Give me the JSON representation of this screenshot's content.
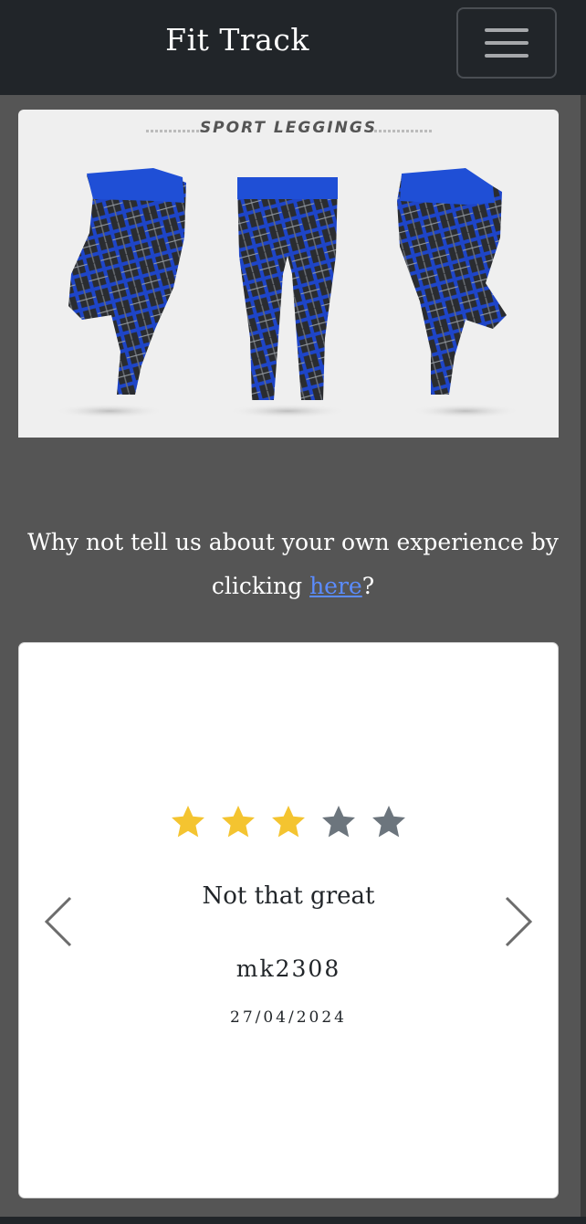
{
  "navbar": {
    "brand": "Fit Track",
    "toggler_icon": "hamburger-menu-icon"
  },
  "product": {
    "banner": "SPORT LEGGINGS",
    "image_subject": "sport-leggings-front-side-back",
    "colors": {
      "waistband": "#1f4fd6",
      "base": "#2a2c30",
      "accent": "#1e45c8"
    }
  },
  "cta": {
    "prefix": "Why not tell us about your own experience by clicking ",
    "link_text": "here",
    "suffix": "?"
  },
  "review": {
    "rating": 3,
    "max_rating": 5,
    "title": "Not that great",
    "author": "mk2308",
    "date": "27/04/2024",
    "star_filled_color": "#f4c430",
    "star_empty_color": "#6c757d",
    "prev_icon": "chevron-left-icon",
    "next_icon": "chevron-right-icon"
  },
  "colors": {
    "navbar_bg": "#212529",
    "page_bg": "#555555",
    "link": "#5b8cff"
  }
}
